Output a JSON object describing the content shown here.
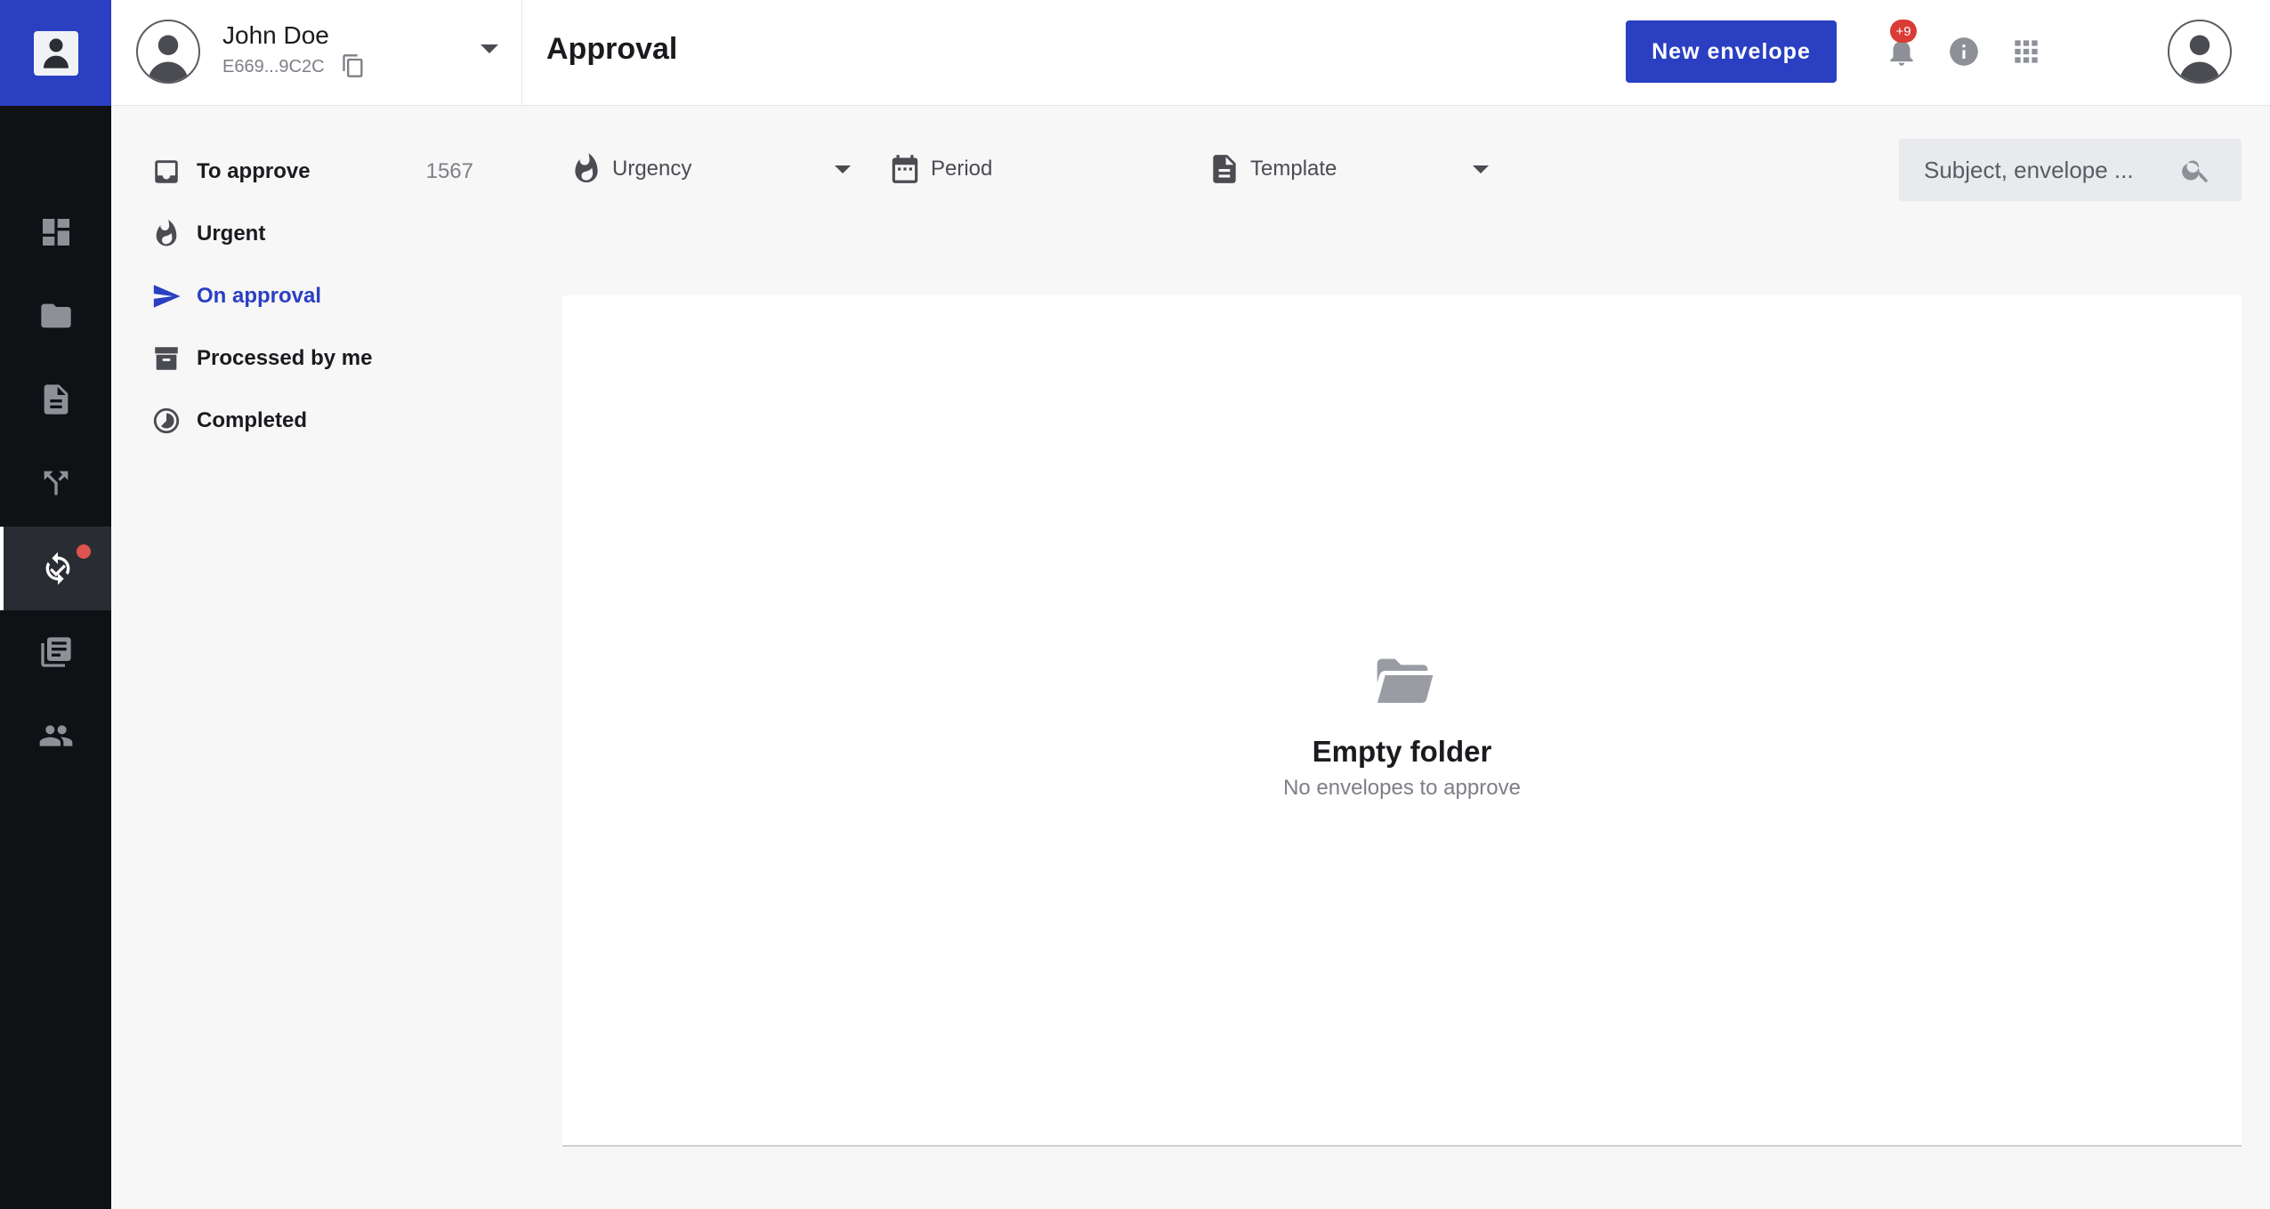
{
  "account": {
    "name": "John Doe",
    "id": "E669...9C2C"
  },
  "header": {
    "title": "Approval",
    "new_button": "New envelope",
    "notification_badge": "+9"
  },
  "rail": {
    "items": [
      {
        "icon": "dashboard-icon"
      },
      {
        "icon": "folder-icon"
      },
      {
        "icon": "document-icon"
      },
      {
        "icon": "route-icon"
      },
      {
        "icon": "approval-icon",
        "active": true,
        "has_dot": true
      },
      {
        "icon": "library-icon"
      },
      {
        "icon": "contacts-icon"
      }
    ]
  },
  "nav": {
    "items": [
      {
        "label": "To approve",
        "count": "1567",
        "icon": "inbox-icon"
      },
      {
        "label": "Urgent",
        "icon": "fire-icon"
      },
      {
        "label": "On approval",
        "icon": "send-icon",
        "active": true
      },
      {
        "label": "Processed by me",
        "icon": "archive-icon"
      },
      {
        "label": "Completed",
        "icon": "progress-icon"
      }
    ]
  },
  "filters": {
    "urgency": "Urgency",
    "period": "Period",
    "template": "Template"
  },
  "search": {
    "placeholder": "Subject, envelope ..."
  },
  "empty": {
    "title": "Empty folder",
    "subtitle": "No envelopes to approve"
  },
  "colors": {
    "accent": "#2a3fc2",
    "rail": "#0f1115",
    "badge": "#d93b36"
  }
}
